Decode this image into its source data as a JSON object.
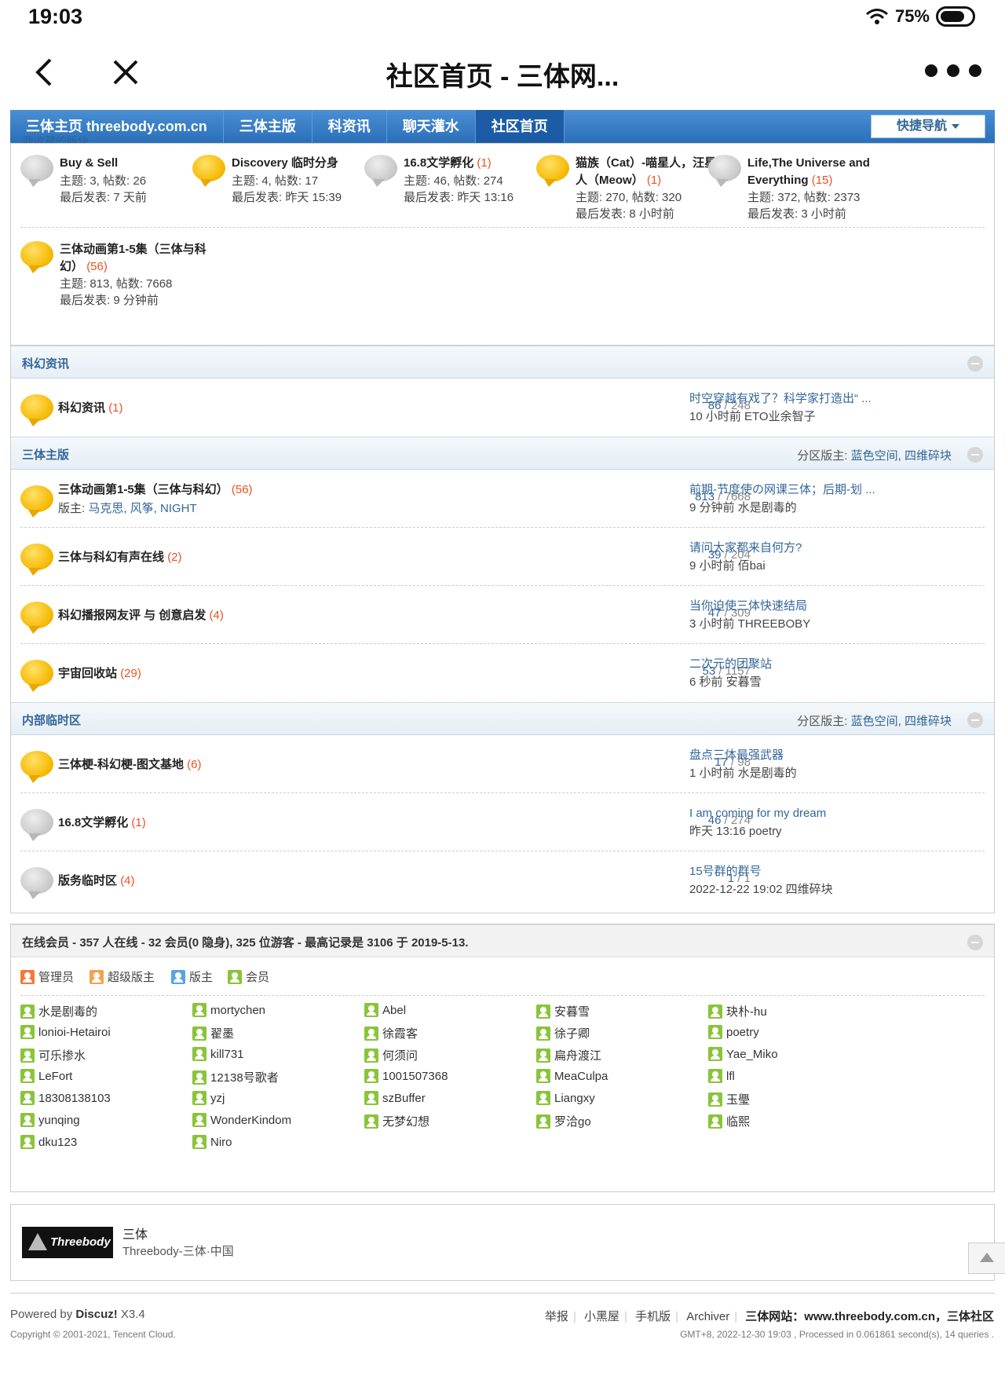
{
  "status": {
    "time": "19:03",
    "battery": "75%"
  },
  "browser": {
    "title": "社区首页 - 三体网..."
  },
  "sitenav": {
    "items": [
      "三体主页 threebody.com.cn",
      "三体主版",
      "科资讯",
      "聊天灌水",
      "社区首页"
    ],
    "quick": "快捷导航",
    "ghost": "我收藏的版块"
  },
  "favorites": [
    {
      "name": "Buy & Sell",
      "count": "",
      "topics": "主题: 3, 帖数: 26",
      "last": "最后发表: 7 天前",
      "icon": "inactive"
    },
    {
      "name": "Discovery 临时分身",
      "count": "",
      "topics": "主题: 4, 帖数: 17",
      "last": "最后发表: 昨天 15:39",
      "icon": "active"
    },
    {
      "name": "16.8文学孵化",
      "count": "(1)",
      "topics": "主题: 46, 帖数: 274",
      "last": "最后发表: 昨天 13:16",
      "icon": "inactive"
    },
    {
      "name": "猫族（Cat）-喵星人，汪星人（Meow）",
      "count": "(1)",
      "topics": "主题: 270, 帖数: 320",
      "last": "最后发表: 8 小时前",
      "icon": "active"
    },
    {
      "name": "Life,The Universe and Everything",
      "count": "(15)",
      "topics": "主题: 372, 帖数: 2373",
      "last": "最后发表: 3 小时前",
      "icon": "inactive"
    },
    {
      "name": "三体动画第1-5集（三体与科幻）",
      "count": "(56)",
      "topics": "主题: 813, 帖数: 7668",
      "last": "最后发表: 9 分钟前",
      "icon": "active"
    }
  ],
  "sections": [
    {
      "title": "科幻资讯",
      "mod_label": "",
      "mods": [],
      "forums": [
        {
          "name": "科幻资讯",
          "count": "(1)",
          "mods_label": "",
          "mods": "",
          "topics": "86",
          "posts": "248",
          "last_title": "时空穿越有戏了？科学家打造出“ ...",
          "last_meta": "10 小时前 ETO业余智子",
          "icon": "active"
        }
      ]
    },
    {
      "title": "三体主版",
      "mod_label": "分区版主: ",
      "mods": [
        "蓝色空间",
        "四维碎块"
      ],
      "forums": [
        {
          "name": "三体动画第1-5集（三体与科幻）",
          "count": "(56)",
          "mods_label": "版主: ",
          "mods": "马克思, 风筝, NIGHT",
          "topics": "813",
          "posts": "7668",
          "last_title": "前期-节度使の网课三体；后期-划 ...",
          "last_meta": "9 分钟前 水是剧毒的",
          "icon": "active"
        },
        {
          "name": "三体与科幻有声在线",
          "count": "(2)",
          "mods_label": "",
          "mods": "",
          "topics": "39",
          "posts": "204",
          "last_title": "请问大家都来自何方?",
          "last_meta": "9 小时前 佰bai",
          "icon": "active"
        },
        {
          "name": "科幻播报网友评 与 创意启发",
          "count": "(4)",
          "mods_label": "",
          "mods": "",
          "topics": "47",
          "posts": "309",
          "last_title": "当你迫使三体快速结局",
          "last_meta": "3 小时前 THREEBOBY",
          "icon": "active"
        },
        {
          "name": "宇宙回收站",
          "count": "(29)",
          "mods_label": "",
          "mods": "",
          "topics": "53",
          "posts": "1157",
          "last_title": "二次元的团聚站",
          "last_meta": "6 秒前 安暮雪",
          "icon": "active"
        }
      ]
    },
    {
      "title": "内部临时区",
      "mod_label": "分区版主: ",
      "mods": [
        "蓝色空间",
        "四维碎块"
      ],
      "forums": [
        {
          "name": "三体梗-科幻梗-图文基地",
          "count": "(6)",
          "mods_label": "",
          "mods": "",
          "topics": "17",
          "posts": "98",
          "last_title": "盘点三体最强武器",
          "last_meta": "1 小时前 水是剧毒的",
          "icon": "active"
        },
        {
          "name": "16.8文学孵化",
          "count": "(1)",
          "mods_label": "",
          "mods": "",
          "topics": "46",
          "posts": "274",
          "last_title": "I am coming for my dream",
          "last_meta": "昨天 13:16 poetry",
          "icon": "inactive"
        },
        {
          "name": "版务临时区",
          "count": "(4)",
          "mods_label": "",
          "mods": "",
          "topics": "1",
          "posts": "1",
          "last_title": "15号群的群号",
          "last_meta": "2022-12-22 19:02 四维碎块",
          "icon": "inactive"
        }
      ]
    }
  ],
  "online": {
    "title": "在线会员 - 357 人在线 - 32 会员(0 隐身), 325 位游客 - 最高记录是 3106 于 2019-5-13.",
    "legend": [
      {
        "label": "管理员",
        "role": "admin"
      },
      {
        "label": "超级版主",
        "role": "super"
      },
      {
        "label": "版主",
        "role": "mod"
      },
      {
        "label": "会员",
        "role": "member"
      }
    ],
    "users": [
      "水是剧毒的",
      "mortychen",
      "Abel",
      "安暮雪",
      "玦朴-hu",
      "lonioi-Hetairoi",
      "翟墨",
      "徐霞客",
      "徐子卿",
      "poetry",
      "可乐掺水",
      "kill731",
      "何须问",
      "扁舟渡江",
      "Yae_Miko",
      "LeFort",
      "12138号歌者",
      "1001507368",
      "MeaCulpa",
      "lfl",
      "18308138103",
      "yzj",
      "szBuffer",
      "Liangxy",
      "玉璺",
      "yunqing",
      "WonderKindom",
      "无梦幻想",
      "罗洽go",
      "临熙",
      "dku123",
      "Niro"
    ]
  },
  "brand": {
    "logo": "Threebody",
    "name": "三体",
    "sub": "Threebody-三体·中国"
  },
  "footer": {
    "powered_prefix": "Powered by ",
    "powered_name": "Discuz!",
    "powered_ver": " X3.4",
    "copyright": "Copyright © 2001-2021, Tencent Cloud.",
    "links": [
      "举报",
      "小黑屋",
      "手机版",
      "Archiver"
    ],
    "site": "三体网站：www.threebody.com.cn，三体社区",
    "gmt": "GMT+8, 2022-12-30 19:03 , Processed in 0.061861 second(s), 14 queries ."
  }
}
